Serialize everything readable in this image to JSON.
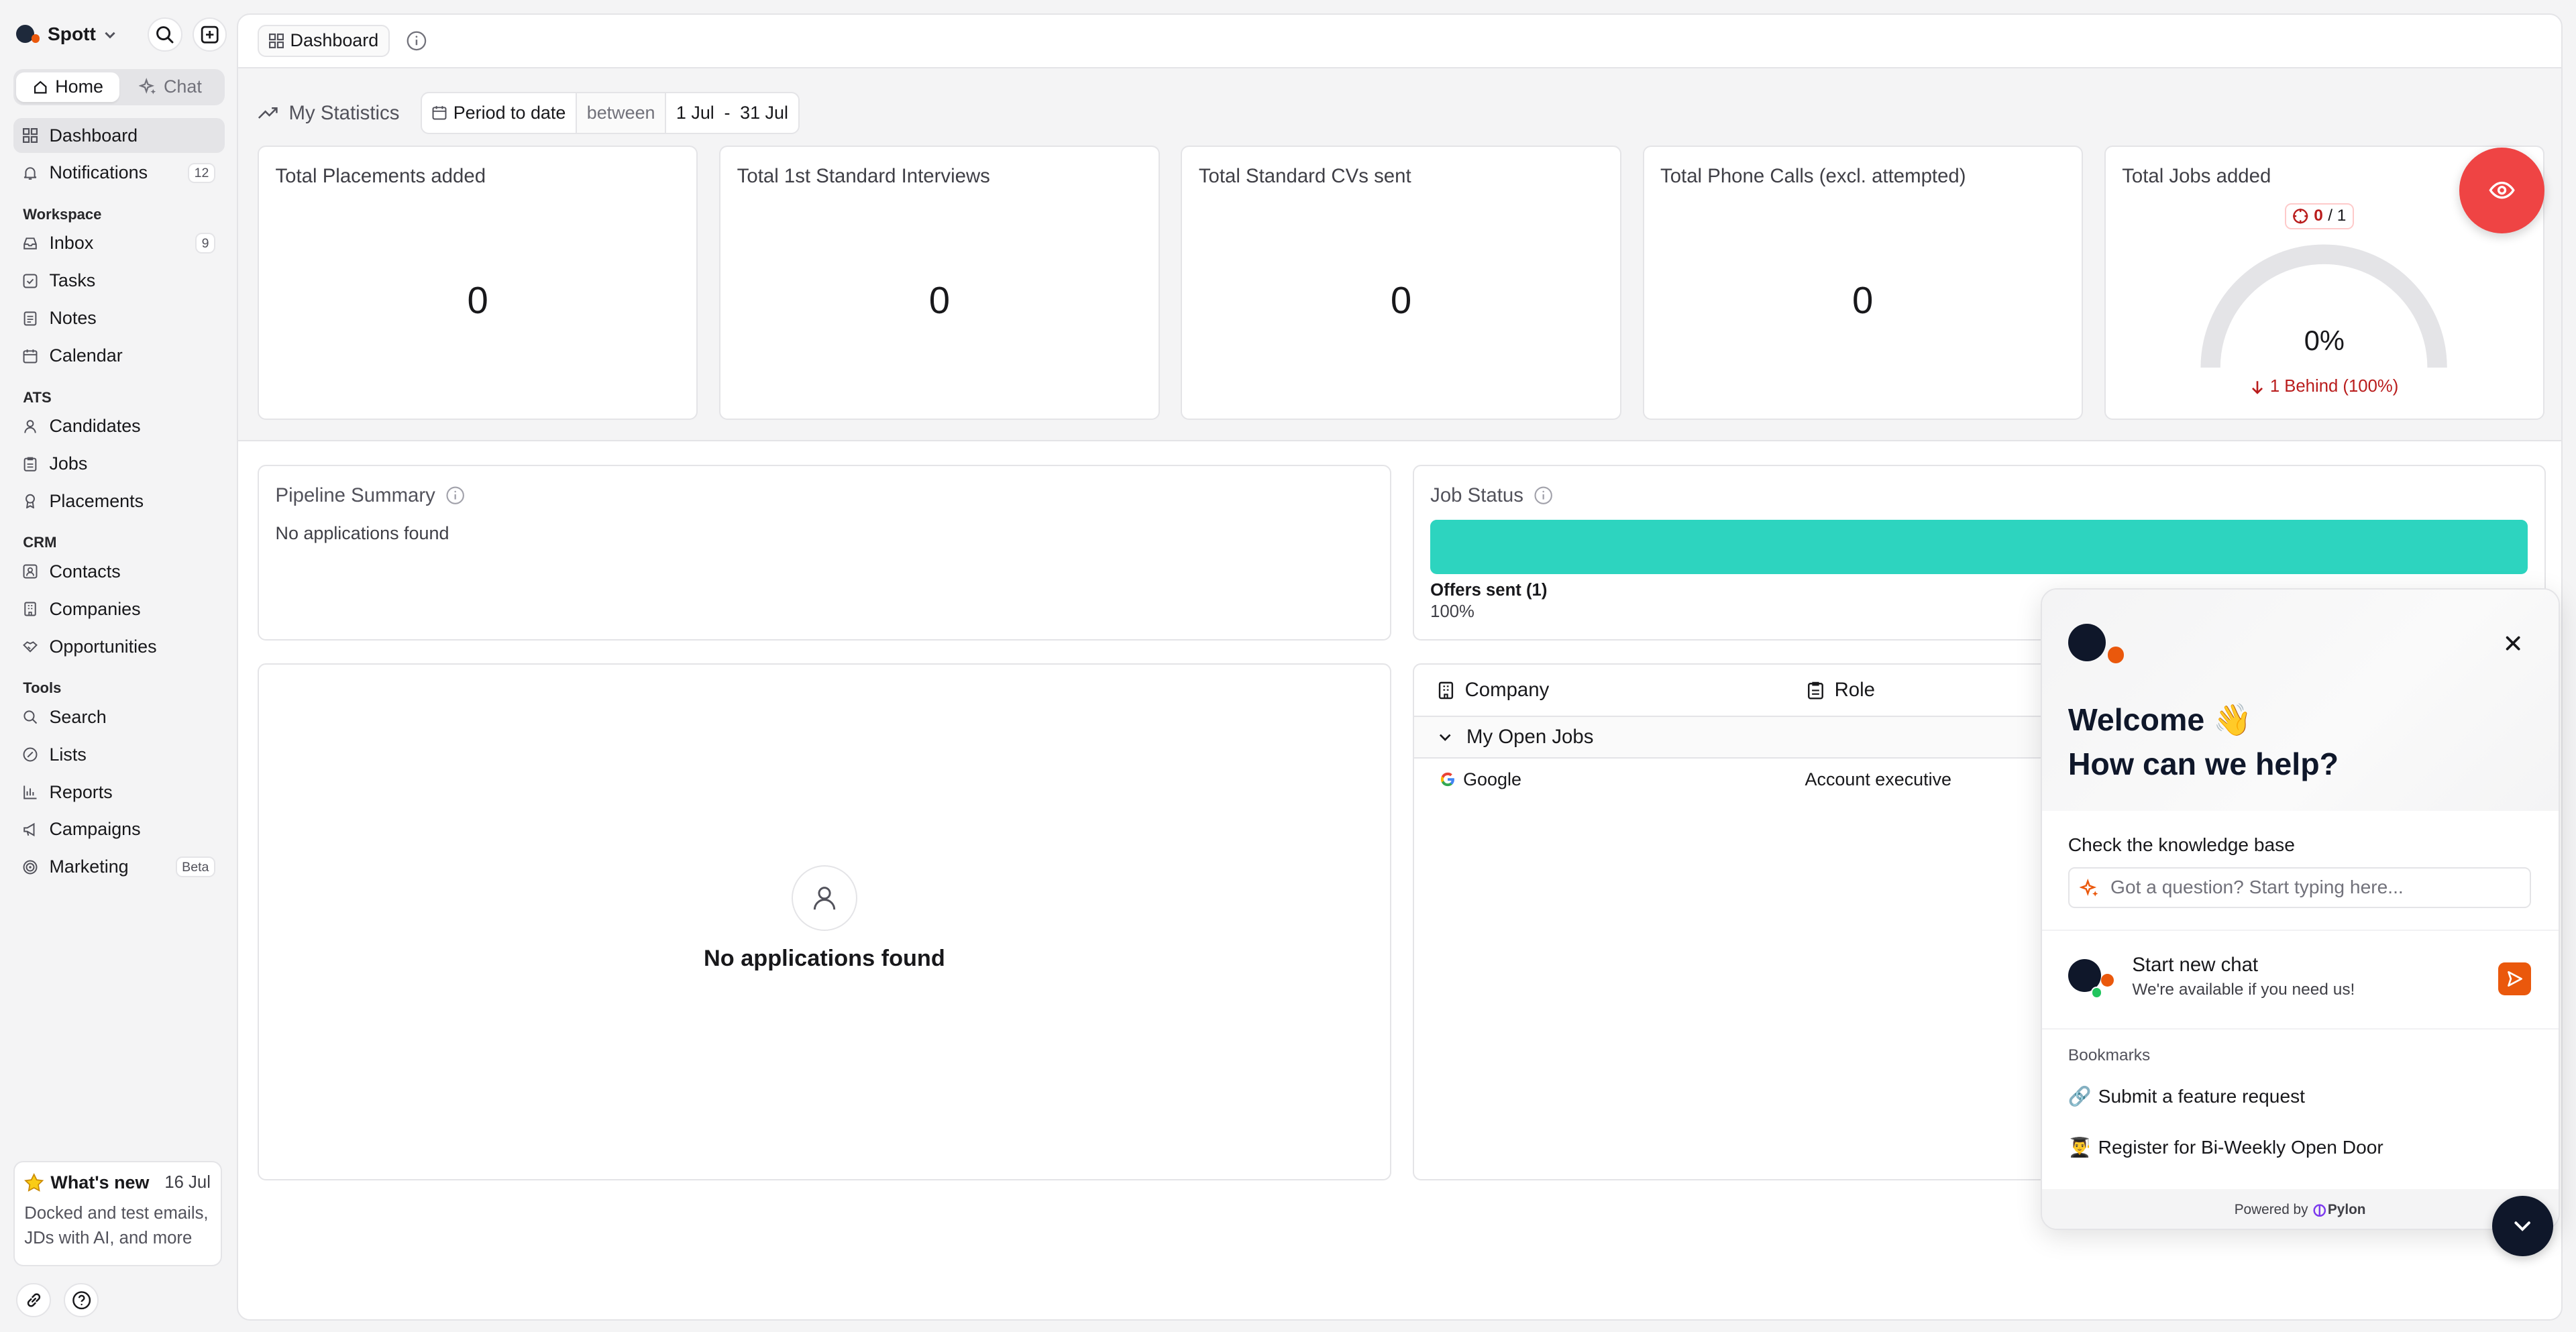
{
  "brand": {
    "name": "Spott"
  },
  "sidebar": {
    "tabs": [
      {
        "label": "Home"
      },
      {
        "label": "Chat"
      }
    ],
    "items": [
      {
        "label": "Dashboard",
        "icon": "grid-icon"
      },
      {
        "label": "Notifications",
        "icon": "bell-icon",
        "badge": "12"
      }
    ],
    "sections": [
      {
        "label": "Workspace",
        "items": [
          {
            "label": "Inbox",
            "icon": "inbox-icon",
            "badge": "9"
          },
          {
            "label": "Tasks",
            "icon": "check-square-icon"
          },
          {
            "label": "Notes",
            "icon": "note-icon"
          },
          {
            "label": "Calendar",
            "icon": "calendar-icon"
          }
        ]
      },
      {
        "label": "ATS",
        "items": [
          {
            "label": "Candidates",
            "icon": "user-icon"
          },
          {
            "label": "Jobs",
            "icon": "clipboard-icon"
          },
          {
            "label": "Placements",
            "icon": "award-icon"
          }
        ]
      },
      {
        "label": "CRM",
        "items": [
          {
            "label": "Contacts",
            "icon": "contact-icon"
          },
          {
            "label": "Companies",
            "icon": "building-icon"
          },
          {
            "label": "Opportunities",
            "icon": "handshake-icon"
          }
        ]
      },
      {
        "label": "Tools",
        "items": [
          {
            "label": "Search",
            "icon": "search-icon"
          },
          {
            "label": "Lists",
            "icon": "list-icon"
          },
          {
            "label": "Reports",
            "icon": "bar-chart-icon"
          },
          {
            "label": "Campaigns",
            "icon": "megaphone-icon"
          },
          {
            "label": "Marketing",
            "icon": "target-icon",
            "badge": "Beta"
          }
        ]
      }
    ],
    "whats_new": {
      "title": "What's new",
      "date": "16 Jul",
      "desc": "Docked and test emails, JDs with AI, and more"
    }
  },
  "topbar": {
    "crumb": "Dashboard"
  },
  "stats": {
    "title": "My Statistics",
    "period_label": "Period to date",
    "between": "between",
    "range_start": "1 Jul",
    "range_sep": "-",
    "range_end": "31 Jul",
    "cards": [
      {
        "title": "Total Placements added",
        "value": "0"
      },
      {
        "title": "Total 1st Standard Interviews",
        "value": "0"
      },
      {
        "title": "Total Standard CVs sent",
        "value": "0"
      },
      {
        "title": "Total Phone Calls (excl. attempted)",
        "value": "0"
      }
    ],
    "goal_card": {
      "title": "Total Jobs added",
      "current": "0",
      "goal": "/ 1",
      "percent_label": "0%",
      "progress": 0,
      "behind": "1 Behind (100%)"
    }
  },
  "pipeline": {
    "title": "Pipeline Summary",
    "empty": "No applications found"
  },
  "job_status": {
    "title": "Job Status",
    "bar_color": "#2dd4bf",
    "legend": "Offers sent (1)",
    "legend_pct": "100%",
    "share": 1.0
  },
  "applications": {
    "empty": "No applications found"
  },
  "jobs_table": {
    "columns": [
      {
        "label": "Company"
      },
      {
        "label": "Role"
      }
    ],
    "group": "My Open Jobs",
    "rows": [
      {
        "company": "Google",
        "role": "Account executive"
      }
    ]
  },
  "widget": {
    "welcome": "Welcome 👋",
    "help": "How can we help?",
    "kb_label": "Check the knowledge base",
    "kb_placeholder": "Got a question? Start typing here...",
    "chat_title": "Start new chat",
    "chat_sub": "We're available if you need us!",
    "bookmarks_label": "Bookmarks",
    "bookmarks": [
      {
        "emoji": "🔗",
        "label": "Submit a feature request"
      },
      {
        "emoji": "👨‍🎓",
        "label": "Register for Bi-Weekly Open Door"
      }
    ],
    "powered_by": "Powered by",
    "powered_brand": "Pylon"
  },
  "colors": {
    "accent_red": "#ef4444",
    "brand_orange": "#ea580c",
    "teal": "#2dd4bf",
    "navy": "#0f172a"
  }
}
